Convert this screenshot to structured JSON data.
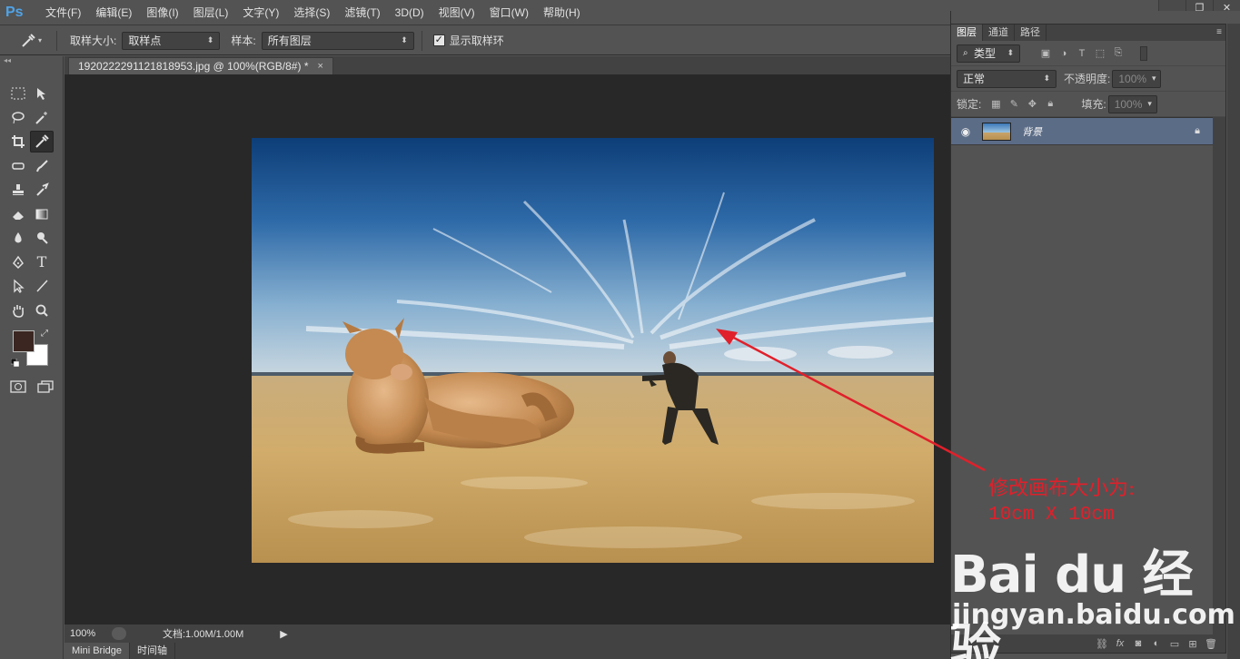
{
  "app": {
    "logo": "Ps"
  },
  "menu": {
    "items": [
      "文件(F)",
      "编辑(E)",
      "图像(I)",
      "图层(L)",
      "文字(Y)",
      "选择(S)",
      "滤镜(T)",
      "3D(D)",
      "视图(V)",
      "窗口(W)",
      "帮助(H)"
    ]
  },
  "window_controls": {
    "minimize": "▁",
    "restore": "❐",
    "close": "✕"
  },
  "options": {
    "sample_size_label": "取样大小:",
    "sample_size_value": "取样点",
    "sample_label": "样本:",
    "sample_value": "所有图层",
    "show_ring_label": "显示取样环",
    "show_ring_checked": "✓"
  },
  "colors": {
    "foreground": "#3b2621",
    "background": "#ffffff",
    "accent_red": "#e0202b"
  },
  "document": {
    "tab_title": "1920222291121818953.jpg @ 100%(RGB/8#) *",
    "tab_close": "×",
    "zoom": "100%",
    "doc_size": "文档:1.00M/1.00M"
  },
  "bottom_tabs": [
    "Mini Bridge",
    "时间轴"
  ],
  "layers_panel": {
    "tabs": [
      "图层",
      "通道",
      "路径"
    ],
    "filter_kind": "类型",
    "blend_mode": "正常",
    "opacity_label": "不透明度:",
    "opacity_value": "100%",
    "lock_label": "锁定:",
    "fill_label": "填充:",
    "fill_value": "100%",
    "layer_name": "背景"
  },
  "annotation": {
    "line1": "修改画布大小为:",
    "line2": "10cm X 10cm"
  },
  "watermark": {
    "logo": "Bai du 经验",
    "url": "jingyan.baidu.com"
  }
}
